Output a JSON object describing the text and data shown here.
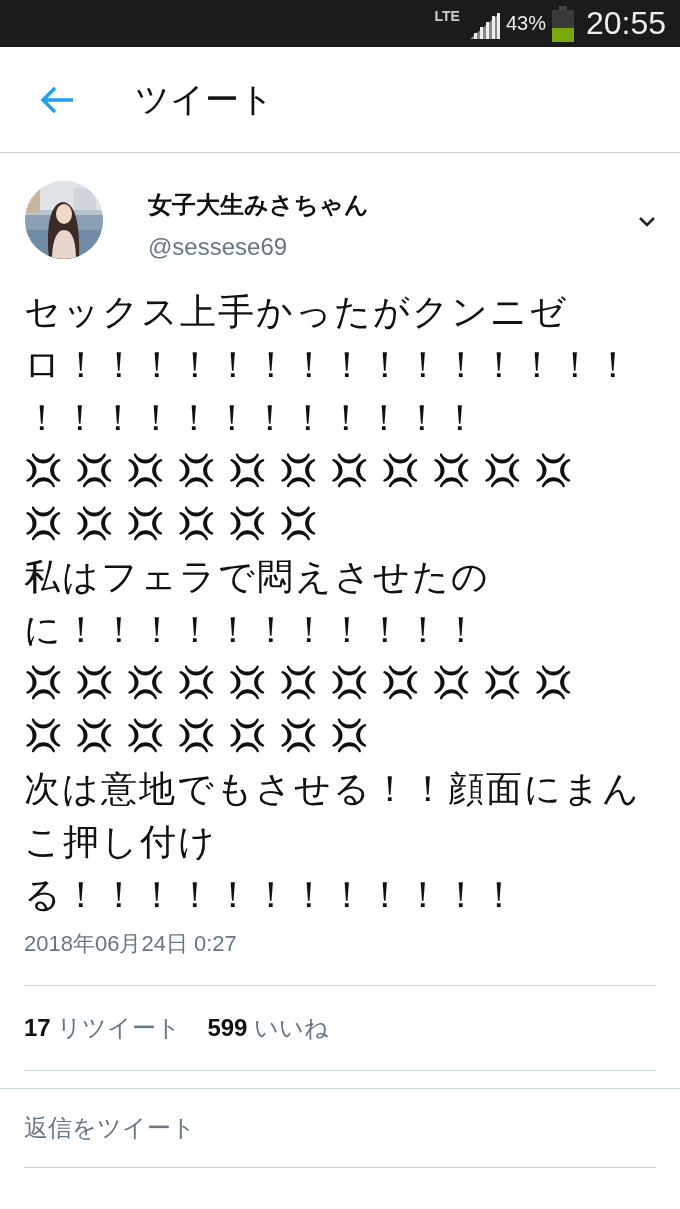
{
  "status_bar": {
    "network": "LTE",
    "battery": "43%",
    "time": "20:55"
  },
  "header": {
    "title": "ツイート"
  },
  "tweet": {
    "name": "女子大生みさちゃん",
    "handle": "@sessese69",
    "lines": [
      {
        "kind": "text",
        "text": "セックス上手かったがクンニゼ"
      },
      {
        "kind": "text",
        "text": "ロ！！！！！！！！！！！！！！！"
      },
      {
        "kind": "text",
        "text": "！！！！！！！！！！！！"
      },
      {
        "kind": "marks",
        "text": "💢💢💢💢💢💢💢💢💢💢💢"
      },
      {
        "kind": "marks",
        "text": "💢💢💢💢💢💢"
      },
      {
        "kind": "text",
        "text": "私はフェラで悶えさせたの"
      },
      {
        "kind": "text",
        "text": "に！！！！！！！！！！！"
      },
      {
        "kind": "marks",
        "text": "💢💢💢💢💢💢💢💢💢💢💢"
      },
      {
        "kind": "marks",
        "text": "💢💢💢💢💢💢💢"
      },
      {
        "kind": "text",
        "text": "次は意地でもさせる！！顔面にまん"
      },
      {
        "kind": "text",
        "text": "こ押し付け"
      },
      {
        "kind": "text",
        "text": "る！！！！！！！！！！！！"
      }
    ],
    "date": "2018年06月24日 0:27",
    "retweets": "17",
    "retweets_label": "リツイート",
    "likes": "599",
    "likes_label": "いいね"
  },
  "reply": {
    "placeholder": "返信をツイート"
  }
}
